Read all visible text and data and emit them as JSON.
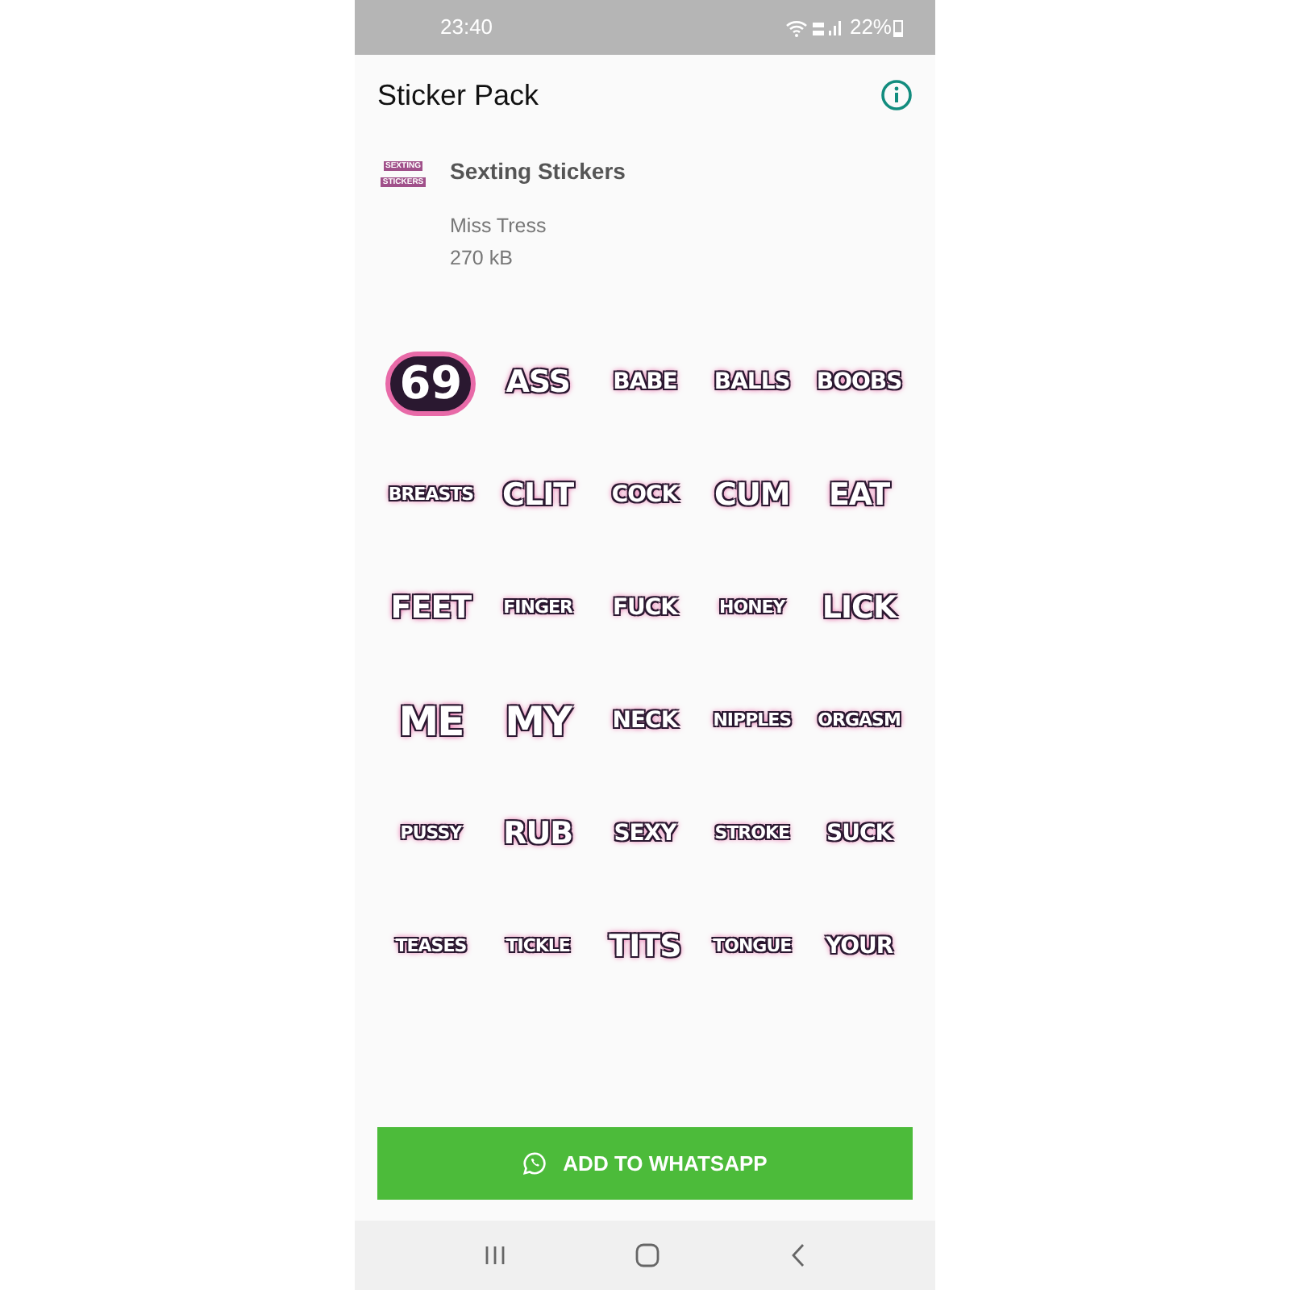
{
  "status_bar": {
    "time": "23:40",
    "battery": "22%"
  },
  "app_bar": {
    "title": "Sticker Pack"
  },
  "pack": {
    "tray_lines": [
      "SEXTING",
      "STICKERS"
    ],
    "name": "Sexting Stickers",
    "author": "Miss Tress",
    "size": "270 kB"
  },
  "stickers": [
    {
      "text": "69",
      "kind": "badge"
    },
    {
      "text": "ASS",
      "kind": "large"
    },
    {
      "text": "BABE",
      "kind": "medium"
    },
    {
      "text": "BALLS",
      "kind": "medium"
    },
    {
      "text": "BOOBS",
      "kind": "medium"
    },
    {
      "text": "BREASTS",
      "kind": "small"
    },
    {
      "text": "CLIT",
      "kind": "large"
    },
    {
      "text": "COCK",
      "kind": "medium"
    },
    {
      "text": "CUM",
      "kind": "large"
    },
    {
      "text": "EAT",
      "kind": "large"
    },
    {
      "text": "FEET",
      "kind": "large"
    },
    {
      "text": "FINGER",
      "kind": "small"
    },
    {
      "text": "FUCK",
      "kind": "medium"
    },
    {
      "text": "HONEY",
      "kind": "small"
    },
    {
      "text": "LICK",
      "kind": "large"
    },
    {
      "text": "ME",
      "kind": "xlarge"
    },
    {
      "text": "MY",
      "kind": "xlarge"
    },
    {
      "text": "NECK",
      "kind": "medium"
    },
    {
      "text": "NIPPLES",
      "kind": "small"
    },
    {
      "text": "ORGASM",
      "kind": "small"
    },
    {
      "text": "PUSSY",
      "kind": "small"
    },
    {
      "text": "RUB",
      "kind": "large"
    },
    {
      "text": "SEXY",
      "kind": "medium"
    },
    {
      "text": "STROKE",
      "kind": "small"
    },
    {
      "text": "SUCK",
      "kind": "medium"
    },
    {
      "text": "TEASES",
      "kind": "small"
    },
    {
      "text": "TICKLE",
      "kind": "small"
    },
    {
      "text": "TITS",
      "kind": "large"
    },
    {
      "text": "TONGUE",
      "kind": "small"
    },
    {
      "text": "YOUR",
      "kind": "medium"
    }
  ],
  "add_button": {
    "label": "ADD TO WHATSAPP"
  }
}
